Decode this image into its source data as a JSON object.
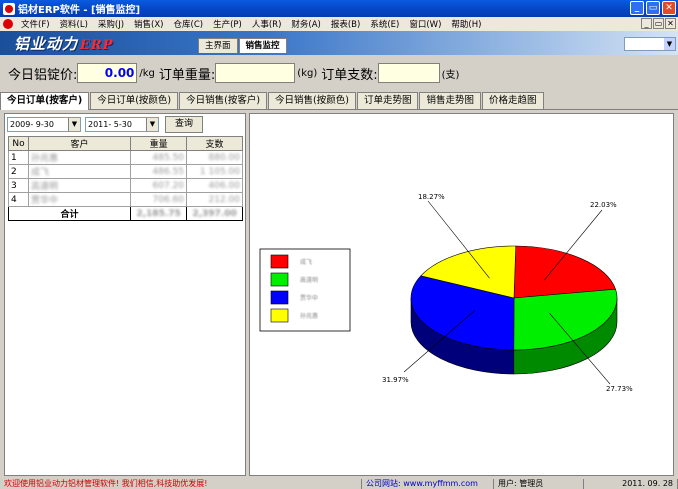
{
  "window": {
    "title": "铝材ERP软件 - [销售监控]",
    "minimize": "_",
    "restore": "▭",
    "close": "✕"
  },
  "menu": {
    "items": [
      "文件(F)",
      "资料(L)",
      "采购(J)",
      "销售(X)",
      "仓库(C)",
      "生产(P)",
      "人事(R)",
      "财务(A)",
      "报表(B)",
      "系统(E)",
      "窗口(W)",
      "帮助(H)"
    ],
    "mdi_buttons": [
      "_",
      "▭",
      "✕"
    ]
  },
  "banner": {
    "logo": "铝业动力",
    "logo_suffix": "ERP",
    "tabs": [
      "主界面",
      "销售监控"
    ],
    "active_tab": "销售监控"
  },
  "stats": {
    "ingot_price_label": "今日铝锭价:",
    "ingot_price_value": "0.00",
    "ingot_price_unit": "/kg",
    "order_weight_label": "订单重量:",
    "order_weight_value": "",
    "order_weight_unit": "(kg)",
    "order_count_label": "订单支数:",
    "order_count_value": "",
    "order_count_unit": "(支)"
  },
  "func_tabs": [
    "今日订单(按客户)",
    "今日订单(按颜色)",
    "今日销售(按客户)",
    "今日销售(按颜色)",
    "订单走势图",
    "销售走势图",
    "价格走趋图"
  ],
  "filter": {
    "start_date": "2009- 9-30",
    "end_date": "2011- 5-30",
    "query_label": "查询"
  },
  "grid": {
    "headers": [
      "No",
      "客户",
      "重量",
      "支数"
    ],
    "rows": [
      {
        "no": "1",
        "customer": "孙兆惠",
        "weight": "485.50",
        "count": "880.00"
      },
      {
        "no": "2",
        "customer": "成飞",
        "weight": "486.55",
        "count": "1 105.00"
      },
      {
        "no": "3",
        "customer": "高遠明",
        "weight": "607.20",
        "count": "406.00"
      },
      {
        "no": "4",
        "customer": "贾华中",
        "weight": "706.60",
        "count": "212.00"
      }
    ],
    "total_label": "合计",
    "total_weight": "2,185.75",
    "total_count": "2,397.00"
  },
  "chart_data": {
    "type": "pie",
    "title": "",
    "categories": [
      "成飞",
      "高遠明",
      "贾华中",
      "孙兆惠"
    ],
    "values": [
      22.03,
      27.73,
      31.97,
      18.27
    ],
    "value_labels": [
      "22.03%",
      "27.73%",
      "31.97%",
      "18.27%"
    ],
    "colors": [
      "#ff0000",
      "#00ee00",
      "#0000ff",
      "#ffff00"
    ],
    "side_colors": [
      "#b00000",
      "#008a00",
      "#00007a",
      "#a8a800"
    ],
    "legend_position": "left",
    "style": "3d"
  },
  "status": {
    "welcome": "欢迎使用铝业动力铝材管理软件! 我们相信,科技助优发展!",
    "website": "公司网站: www.myffmm.com",
    "user": "用户: 管理员",
    "date": "2011. 09. 28"
  }
}
